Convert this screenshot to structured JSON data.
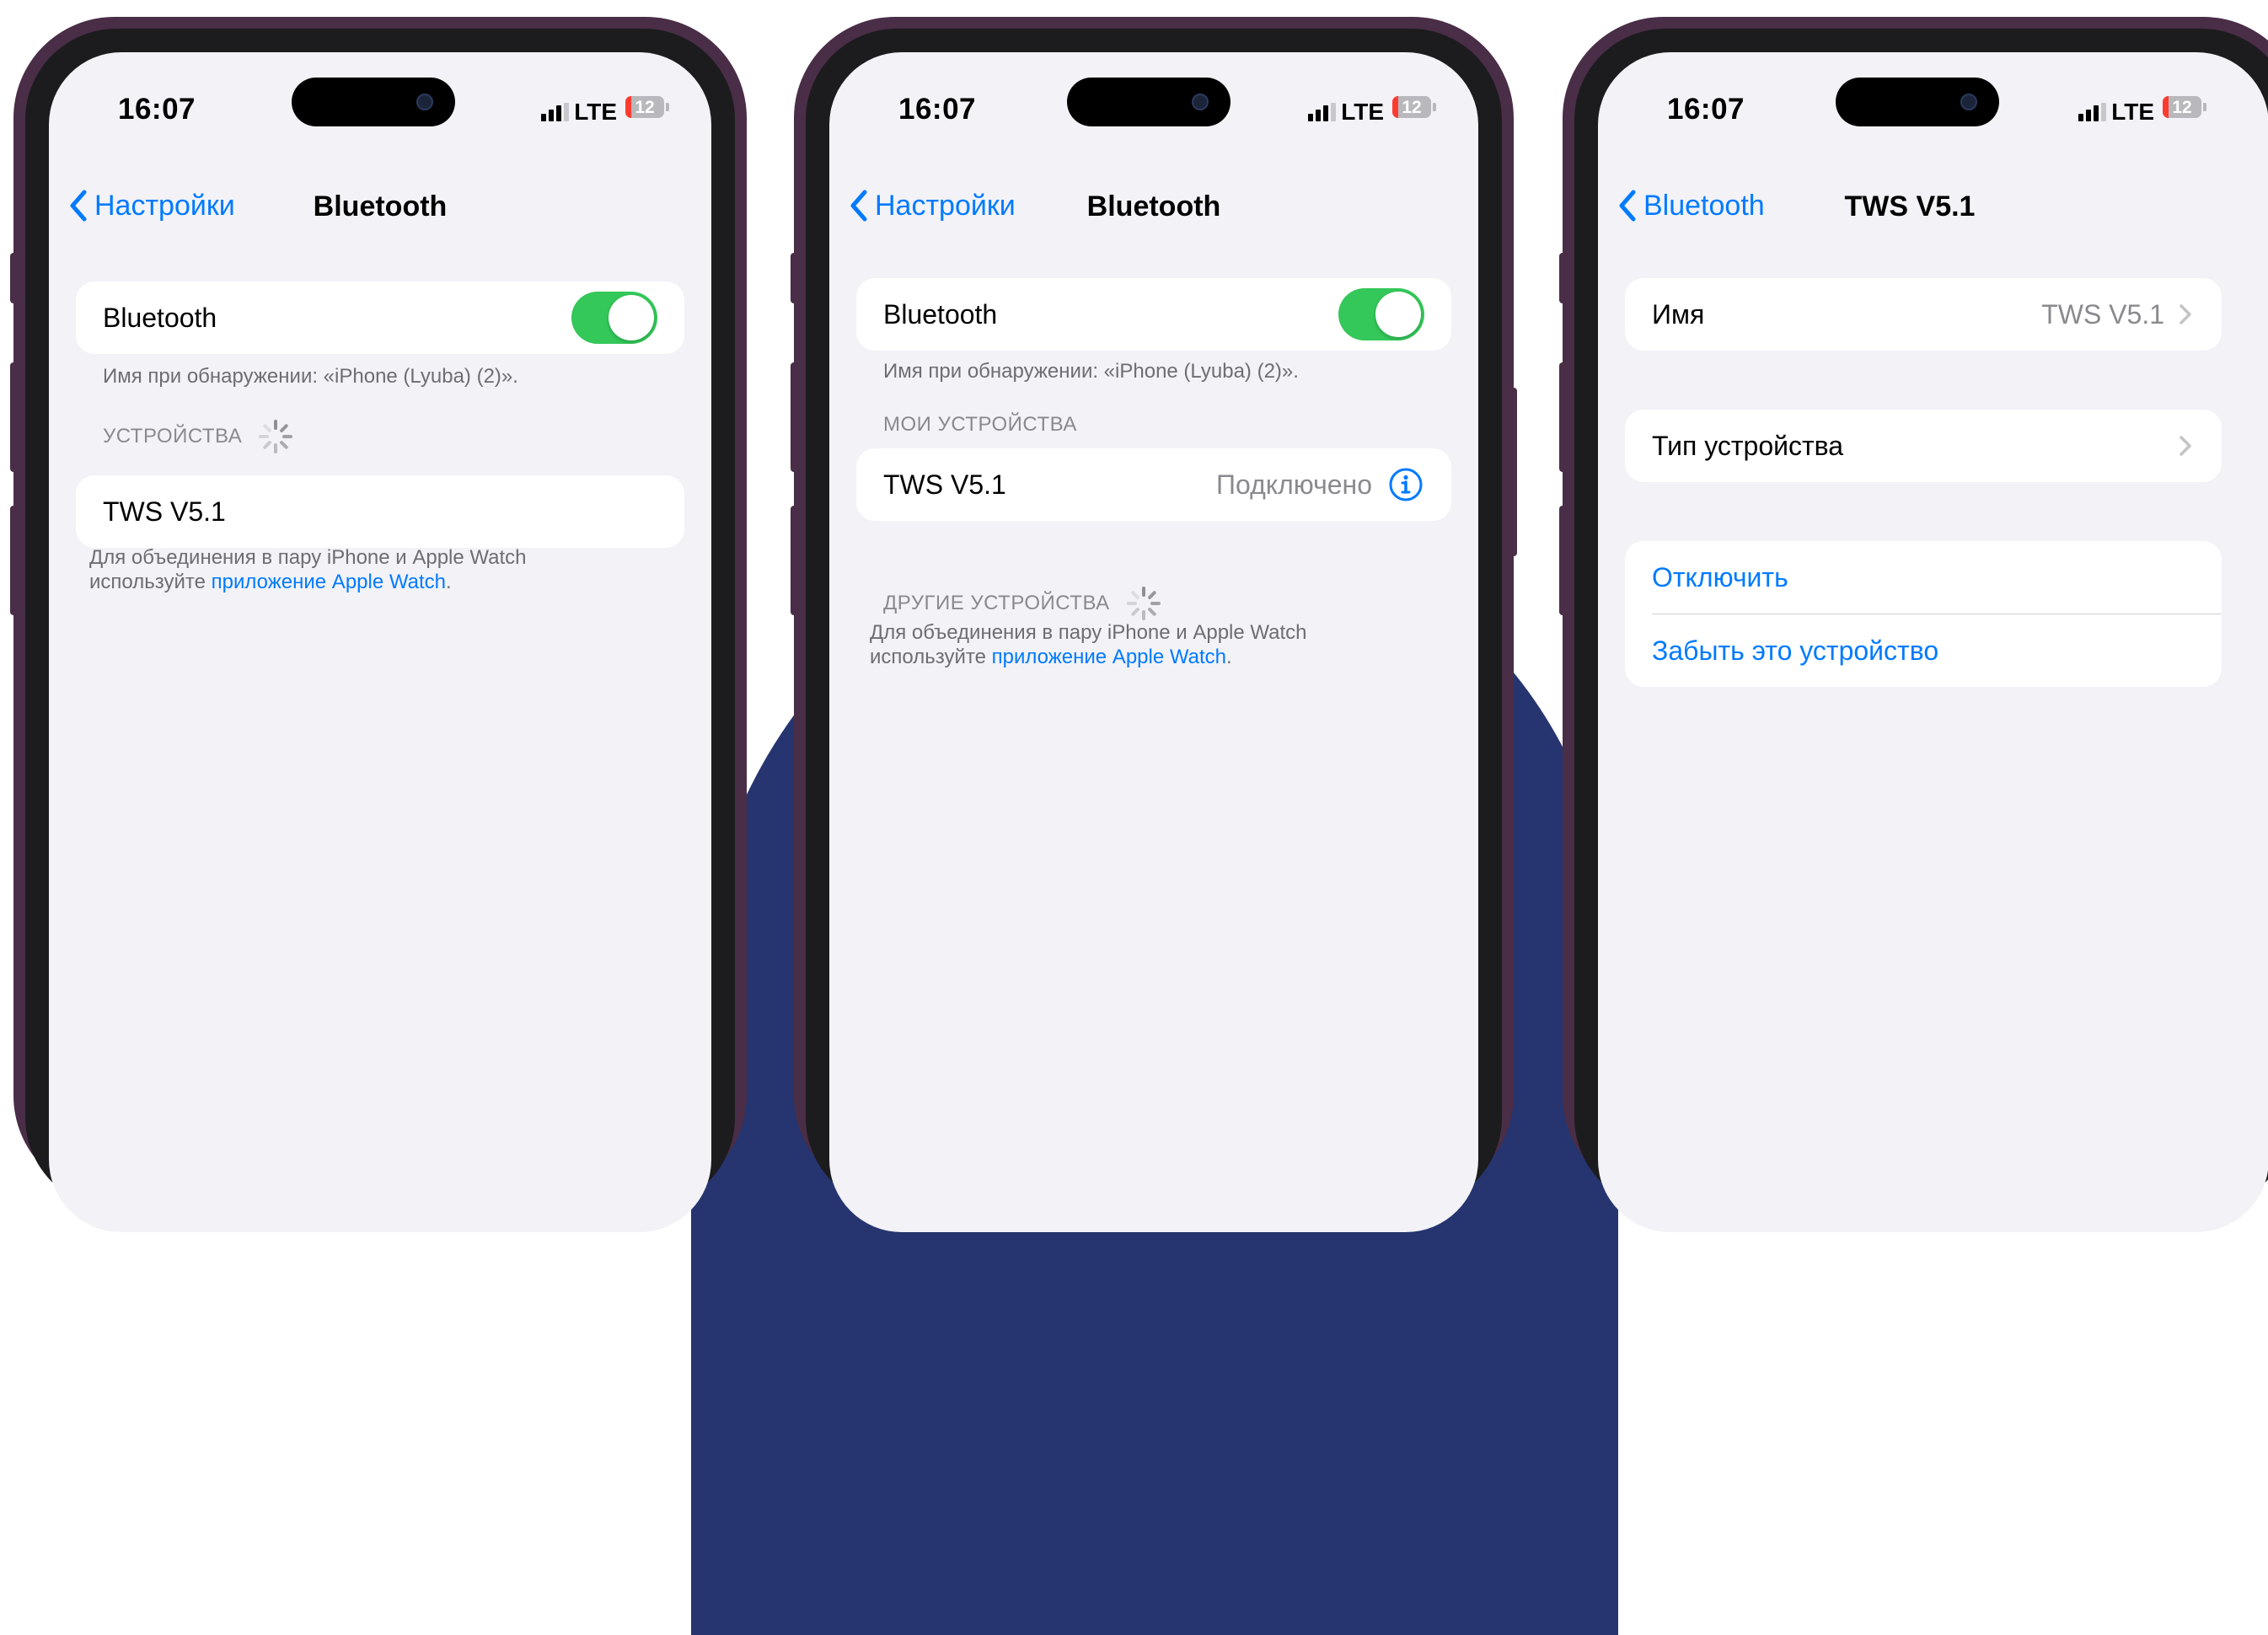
{
  "status_bar": {
    "time": "16:07",
    "network": "LTE",
    "battery": "12",
    "battery_level": 12,
    "icons": [
      "signal-bars-icon",
      "battery-icon"
    ]
  },
  "colors": {
    "accent": "#007aff",
    "toggle_on": "#34c759",
    "background": "#f2f2f7",
    "battery_low": "#ff3b30",
    "backdrop": "#263570"
  },
  "screens": [
    {
      "nav": {
        "back_label": "Настройки",
        "title": "Bluetooth"
      },
      "bluetooth_label": "Bluetooth",
      "bluetooth_on": true,
      "discover_note": "Имя при обнаружении: «iPhone (Lyuba) (2)».",
      "devices_header": "УСТРОЙСТВА",
      "device_name": "TWS V5.1",
      "watch_note_prefix": "Для объединения в пару iPhone и Apple Watch",
      "watch_note_line2": "используйте",
      "watch_note_link": "приложение Apple Watch",
      "watch_note_end": "."
    },
    {
      "nav": {
        "back_label": "Настройки",
        "title": "Bluetooth"
      },
      "bluetooth_label": "Bluetooth",
      "bluetooth_on": true,
      "discover_note": "Имя при обнаружении: «iPhone (Lyuba) (2)».",
      "my_devices_header": "МОИ УСТРОЙСТВА",
      "device_name": "TWS V5.1",
      "device_status": "Подключено",
      "other_devices_header": "ДРУГИЕ УСТРОЙСТВА",
      "watch_note_prefix": "Для объединения в пару iPhone и Apple Watch",
      "watch_note_line2": "используйте",
      "watch_note_link": "приложение Apple Watch",
      "watch_note_end": "."
    },
    {
      "nav": {
        "back_label": "Bluetooth",
        "title": "TWS V5.1"
      },
      "name_label": "Имя",
      "name_value": "TWS V5.1",
      "device_type_label": "Тип устройства",
      "disconnect_label": "Отключить",
      "forget_label": "Забыть это устройство"
    }
  ]
}
